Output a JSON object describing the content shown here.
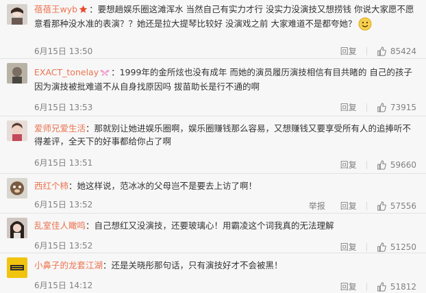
{
  "comments": [
    {
      "user": "蓓蓓王wyb",
      "badge": "star",
      "content": "：要想趟娱乐圈这滩浑水 当然自己有实力才行 没实力没演技又想捞钱 你说大家愿不愿意看那种没水准的表演？？她还是拉大提琴比较好 没演戏之前 大家难道不是都夸她？",
      "emoji": "smiley",
      "time": "6月15日 13:50",
      "reply": "回复",
      "likes": "85424"
    },
    {
      "user": "EXACT_tonelay",
      "badge": "butterfly",
      "content": "：1999年的金所炫也没有成年 而她的演员履历演技相信有目共睹的 自己的孩子因为演技被批难道不从自身找原因吗 拔苗助长是行不通的啊",
      "time": "6月15日 13:53",
      "reply": "回复",
      "likes": "73915"
    },
    {
      "user": "爱师兄爱生活",
      "content": "：那就别让她进娱乐圈啊，娱乐圈赚钱那么容易，又想赚钱又要享受所有人的追捧听不得差评，全天下的好事都给你占了啊",
      "time": "6月15日 13:51",
      "reply": "回复",
      "likes": "59660"
    },
    {
      "user": "西红个柿",
      "content": "：她这样说，范冰冰的父母岂不是要去上访了啊！",
      "time": "6月15日 13:52",
      "report": "举报",
      "reply": "回复",
      "likes": "57556"
    },
    {
      "user": "乱室佳人瞰鸣",
      "content": "：自己想红又没演技，还要玻璃心！用霸凌这个词我真的无法理解",
      "time": "6月15日 13:52",
      "reply": "回复",
      "likes": "51250"
    },
    {
      "user": "小鼻子的龙套江湖",
      "content": "：还是关晓彤那句话，只有演技好才不会被黑！",
      "time": "6月15日 14:12",
      "reply": "回复",
      "likes": "51812"
    }
  ],
  "colors": {
    "username": "#eb7350",
    "meta": "#808080"
  }
}
